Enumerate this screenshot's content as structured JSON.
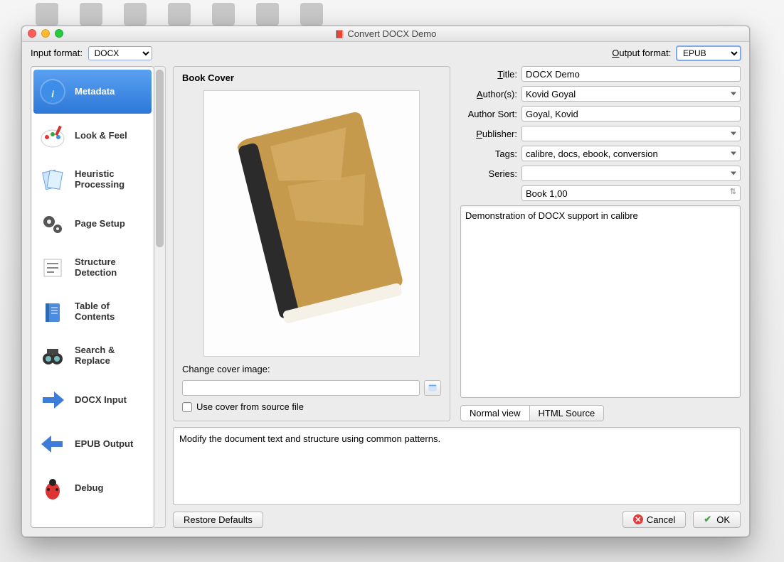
{
  "window": {
    "title": "Convert DOCX Demo"
  },
  "format": {
    "input_label_pre": "Input format:",
    "input_value": "DOCX",
    "output_label_pre": "utput format:",
    "output_underline": "O",
    "output_value": "EPUB"
  },
  "sidebar": {
    "items": [
      {
        "label": "Metadata",
        "icon": "info"
      },
      {
        "label": "Look & Feel",
        "icon": "palette"
      },
      {
        "label": "Heuristic Processing",
        "icon": "cycle"
      },
      {
        "label": "Page Setup",
        "icon": "gears"
      },
      {
        "label": "Structure Detection",
        "icon": "lines"
      },
      {
        "label": "Table of Contents",
        "icon": "book"
      },
      {
        "label": "Search & Replace",
        "icon": "binoculars"
      },
      {
        "label": "DOCX Input",
        "icon": "arrow-right"
      },
      {
        "label": "EPUB Output",
        "icon": "arrow-left"
      },
      {
        "label": "Debug",
        "icon": "bug"
      }
    ]
  },
  "cover": {
    "group_title": "Book Cover",
    "change_label": "Change cover image:",
    "change_underline": "c",
    "path": "",
    "use_source_label": "Use cover from source file",
    "use_source_underline": "s"
  },
  "meta": {
    "title": {
      "label": "Title:",
      "u": "T",
      "value": "DOCX Demo"
    },
    "authors": {
      "label": "uthor(s):",
      "u": "A",
      "value": "Kovid Goyal"
    },
    "author_sort": {
      "label": "Author Sort:",
      "value": "Goyal, Kovid"
    },
    "publisher": {
      "label": "ublisher:",
      "u": "P",
      "value": ""
    },
    "tags": {
      "label": "Tags:",
      "value": "calibre, docs, ebook, conversion"
    },
    "series": {
      "label": "Series:",
      "value": ""
    },
    "series_index": {
      "value": "Book 1,00"
    },
    "description": "Demonstration of DOCX support in calibre",
    "tabs": {
      "normal": "Normal view",
      "html": "HTML Source"
    }
  },
  "help": "Modify the document text and structure using common patterns.",
  "footer": {
    "restore": "Restore Defaults",
    "cancel": "Cancel",
    "ok": "OK"
  }
}
